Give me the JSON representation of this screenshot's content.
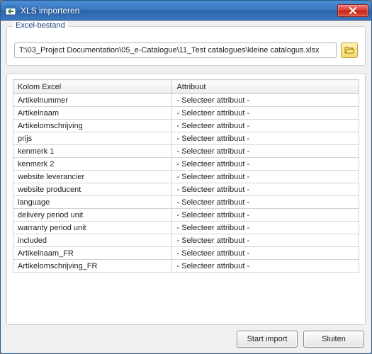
{
  "window": {
    "title": "XLS importeren"
  },
  "filebox": {
    "legend": "Excel-bestand",
    "path": "T:\\03_Project Documentation\\05_e-Catalogue\\11_Test catalogues\\kleine catalogus.xlsx"
  },
  "table": {
    "headers": {
      "col1": "Kolom Excel",
      "col2": "Attribuut"
    },
    "default_attr": "- Selecteer attribuut -",
    "rows": [
      {
        "col": "Artikelnummer"
      },
      {
        "col": "Artikelnaam"
      },
      {
        "col": "Artikelomschrijving"
      },
      {
        "col": "prijs"
      },
      {
        "col": "kenmerk 1"
      },
      {
        "col": "kenmerk 2"
      },
      {
        "col": "website leverancier"
      },
      {
        "col": "website producent"
      },
      {
        "col": "language"
      },
      {
        "col": "delivery period unit"
      },
      {
        "col": "warranty period unit"
      },
      {
        "col": "included"
      },
      {
        "col": "Artikelnaam_FR"
      },
      {
        "col": "Artikelomschrijving_FR"
      }
    ]
  },
  "buttons": {
    "start": "Start import",
    "close": "Sluiten"
  }
}
